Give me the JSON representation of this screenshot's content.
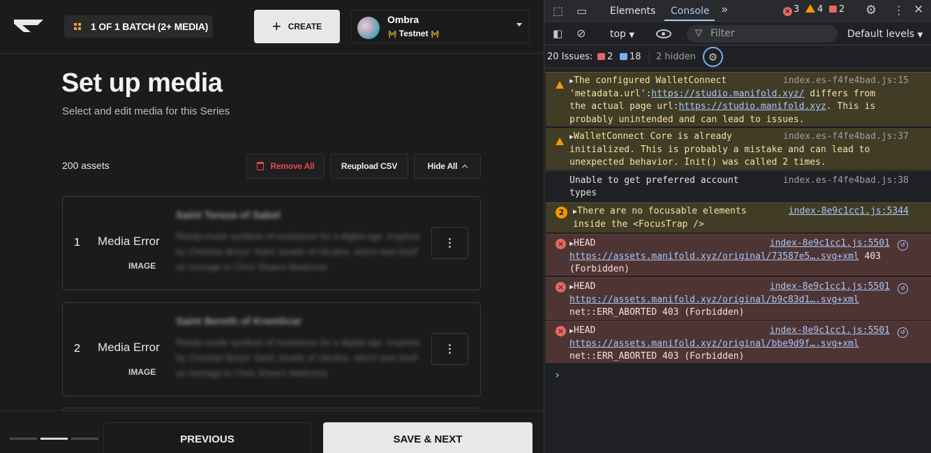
{
  "app": {
    "batch_label": "1 OF 1 BATCH (2+ MEDIA)",
    "create_label": "CREATE",
    "account": {
      "name": "Ombra",
      "network": "Testnet",
      "network_flag": "🚧"
    },
    "page_title": "Set up media",
    "page_subtitle": "Select and edit media for this Series",
    "assets_count": "200 assets",
    "actions": {
      "remove_all": "Remove All",
      "reupload_csv": "Reupload CSV",
      "hide_all": "Hide All"
    },
    "cards": [
      {
        "index": "1",
        "status": "Media Error",
        "type": "IMAGE",
        "title": "Saint Tereza of Sabel",
        "description": "Ready-made symbols of resistance for a digital age. Inspired by Christian Borys' Saint Javelin of Ukraine, which was itself an homage to Chris Shaw's Madonna"
      },
      {
        "index": "2",
        "status": "Media Error",
        "type": "IMAGE",
        "title": "Saint Bereth of Kremlicar",
        "description": "Ready-made symbols of resistance for a digital age. Inspired by Christian Borys' Saint Javelin of Ukraine, which was itself an homage to Chris Shaw's Madonna"
      }
    ],
    "menu_glyph": "⋮",
    "footer": {
      "previous": "PREVIOUS",
      "next": "SAVE & NEXT"
    },
    "colors": {
      "accent_danger": "#e5484d",
      "batch_icon": "#e8a33a"
    }
  },
  "devtools": {
    "tabs": [
      "Elements",
      "Console"
    ],
    "active_tab": "Console",
    "counts": {
      "errors": "3",
      "warnings": "4",
      "issues": "2"
    },
    "toolbar": {
      "context": "top",
      "filter_placeholder": "Filter",
      "levels": "Default levels"
    },
    "issues_bar": {
      "label": "20 Issues:",
      "error_count": "2",
      "info_count": "18",
      "hidden": "2 hidden"
    },
    "messages": [
      {
        "level": "warning",
        "pre": "The configured WalletConnect\n'metadata.url':",
        "link1": "https://studio.manifold.xyz/",
        "mid": " differs from\nthe actual page url:",
        "link2": "https://studio.manifold.xyz",
        "post": ". This is\nprobably unintended and can lead to issues.",
        "source": "index.es-f4fe4bad.js:15"
      },
      {
        "level": "warning",
        "text": "WalletConnect Core is already\ninitialized. This is probably a mistake and can lead to\nunexpected behavior. Init() was called 2 times.",
        "source": "index.es-f4fe4bad.js:37"
      },
      {
        "level": "info",
        "text": "Unable to get preferred account\ntypes",
        "source": "index.es-f4fe4bad.js:38"
      },
      {
        "level": "warning",
        "repeat": "2",
        "text": "There are no focusable elements\ninside the <FocusTrap />",
        "source": "index-8e9c1cc1.js:5344"
      },
      {
        "level": "error",
        "method": "HEAD",
        "url": "https://assets.manifold.xyz/original/73587e5….svg+xml",
        "status_inline": " 403",
        "status": "(Forbidden)",
        "source": "index-8e9c1cc1.js:5501"
      },
      {
        "level": "error",
        "method": "HEAD",
        "url": "https://assets.manifold.xyz/original/b9c83d1….svg+xml",
        "status": "net::ERR_ABORTED 403 (Forbidden)",
        "source": "index-8e9c1cc1.js:5501"
      },
      {
        "level": "error",
        "method": "HEAD",
        "url": "https://assets.manifold.xyz/original/bbe9d9f….svg+xml",
        "status": "net::ERR_ABORTED 403 (Forbidden)",
        "source": "index-8e9c1cc1.js:5501"
      }
    ]
  }
}
